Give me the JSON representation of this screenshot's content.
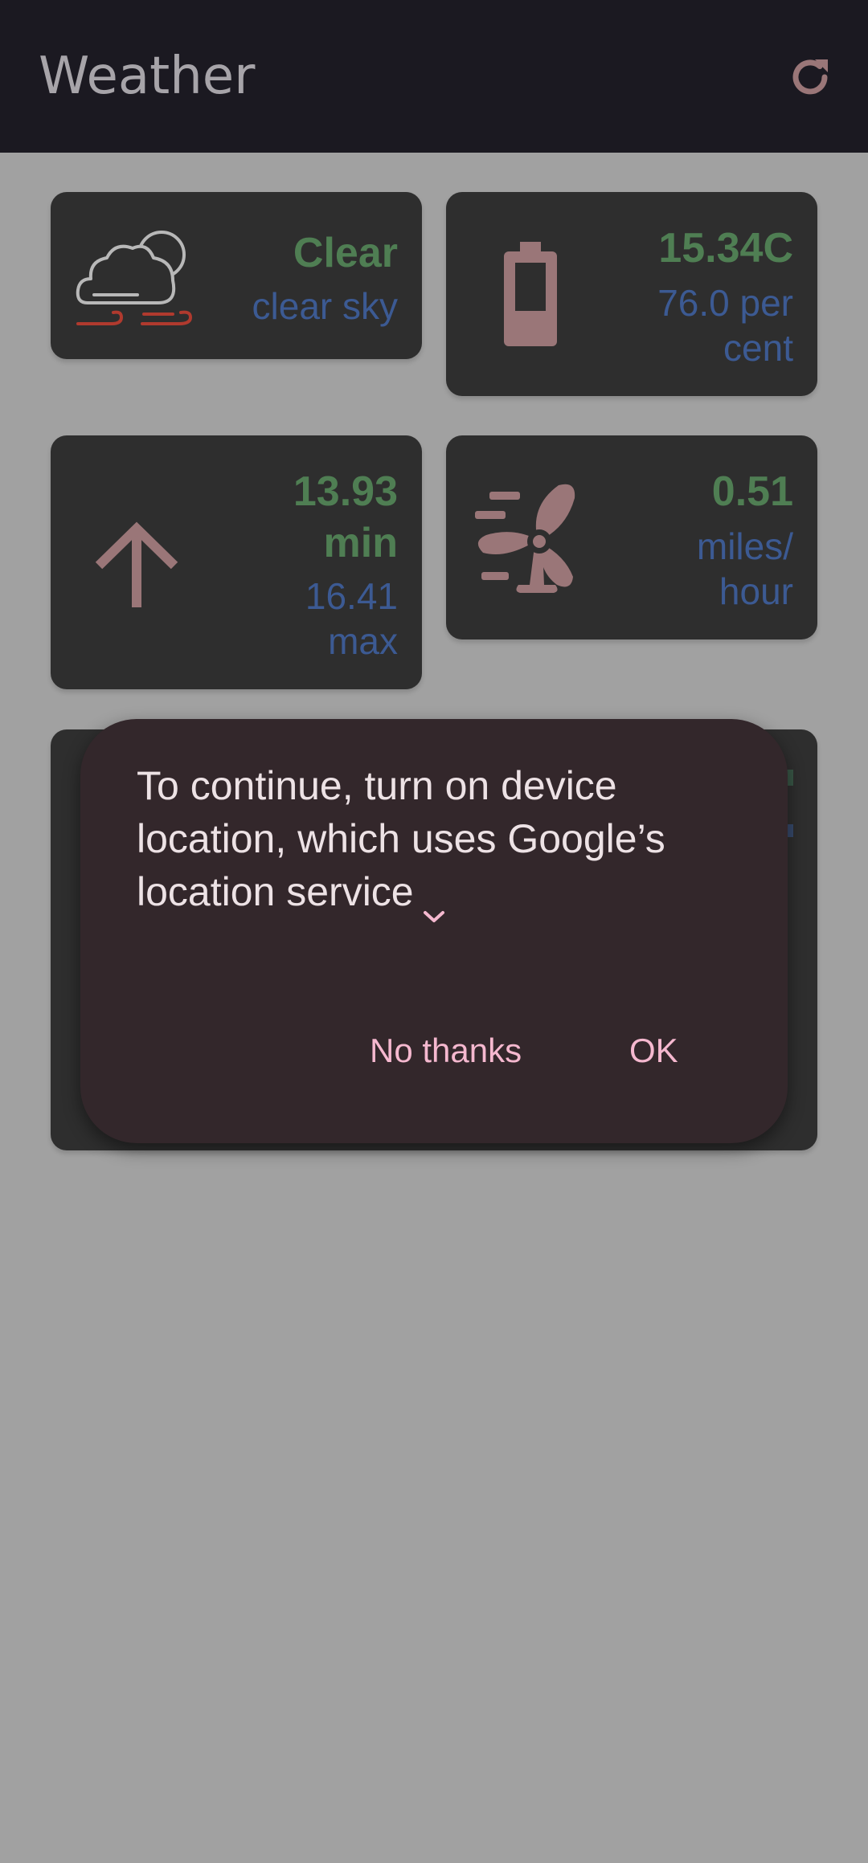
{
  "app": {
    "title": "Weather"
  },
  "toolbar": {
    "refresh_icon": "refresh-icon"
  },
  "cards": {
    "condition": {
      "main": "Clear",
      "description": "clear sky",
      "icon": "cloud-wind-icon"
    },
    "humidity": {
      "temperature": "15.34C",
      "line1": "76.0 per",
      "line2": "cent",
      "icon": "battery-icon"
    },
    "temperature": {
      "min_value": "13.93",
      "min_label": "min",
      "max_value": "16.41",
      "max_label": "max",
      "icon": "arrow-up-icon"
    },
    "wind": {
      "speed": "0.51",
      "unit_line1": "miles/",
      "unit_line2": "hour",
      "icon": "fan-icon"
    }
  },
  "dialog": {
    "message_line1": "To continue, turn on device",
    "message_line2": "location, which uses Google’s",
    "message_line3": "location service",
    "chevron_icon": "chevron-down-icon",
    "no_thanks_label": "No thanks",
    "ok_label": "OK"
  },
  "colors": {
    "scrim": "#a1a1a1",
    "app_bar": "#1b1921",
    "card": "#2e2e2e",
    "value_green": "#4f7e53",
    "sub_blue": "#3c5a93",
    "icon_rose": "#9a7678",
    "dialog_bg": "#33272b",
    "dialog_button": "#f5b8cf"
  }
}
